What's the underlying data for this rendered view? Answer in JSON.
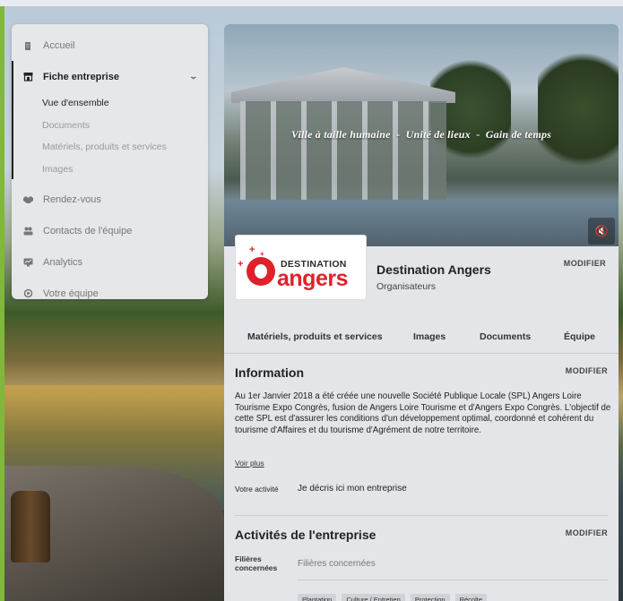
{
  "sidebar": {
    "items": [
      {
        "label": "Accueil",
        "icon": "building-icon"
      },
      {
        "label": "Fiche entreprise",
        "icon": "store-icon",
        "active": true
      },
      {
        "label": "Rendez-vous",
        "icon": "handshake-icon"
      },
      {
        "label": "Contacts de l'équipe",
        "icon": "people-icon"
      },
      {
        "label": "Analytics",
        "icon": "chart-icon"
      },
      {
        "label": "Votre équipe",
        "icon": "gear-icon"
      }
    ],
    "sub_items": [
      "Vue d'ensemble",
      "Documents",
      "Matériels, produits et services",
      "Images"
    ]
  },
  "banner": {
    "tagline": "Ville à taille humaine  -  Unité de lieux  -  Gain de temps"
  },
  "logo": {
    "top": "DESTINATION",
    "bottom": "angers"
  },
  "company": {
    "name": "Destination Angers",
    "category": "Organisateurs",
    "modify_label": "MODIFIER"
  },
  "tabs": [
    "Matériels, produits et services",
    "Images",
    "Documents",
    "Équipe"
  ],
  "information": {
    "title": "Information",
    "modify_label": "MODIFIER",
    "text": "Au 1er Janvier 2018 a été créée une nouvelle Société Publique Locale (SPL) Angers Loire Tourisme Expo Congrès, fusion de Angers Loire Tourisme et d'Angers Expo Congrès.  L'objectif de cette SPL est d'assurer les conditions d'un développement optimal, coordonné et cohérent du tourisme d'Affaires et du tourisme d'Agrément de notre territoire.",
    "see_more": "Voir plus",
    "activity_label": "Votre activité",
    "activity_value": "Je décris ici mon entreprise"
  },
  "activities": {
    "title": "Activités de l'entreprise",
    "modify_label": "MODIFIER",
    "filieres_label": "Filières concernées",
    "filieres_placeholder": "Filières concernées",
    "chips": [
      "Plantation",
      "Culture / Entretien",
      "Protection",
      "Récolte"
    ]
  },
  "colors": {
    "accent_red": "#e0212b",
    "sidebar_bg": "#e6e7e9",
    "card_bg": "#e3e5e8"
  }
}
